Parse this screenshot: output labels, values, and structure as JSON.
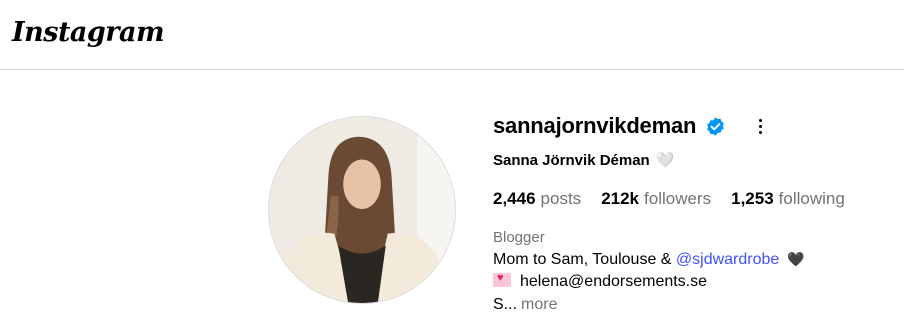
{
  "header": {
    "logo": "Instagram"
  },
  "profile": {
    "username": "sannajornvikdeman",
    "full_name": "Sanna Jörnvik Déman",
    "full_name_emoji": "🤍",
    "stats": {
      "posts_count": "2,446",
      "posts_label": "posts",
      "followers_count": "212k",
      "followers_label": "followers",
      "following_count": "1,253",
      "following_label": "following"
    },
    "category": "Blogger",
    "bio": {
      "line1_prefix": "Mom to Sam, Toulouse & ",
      "line1_mention": "@sjdwardrobe",
      "line1_emoji": "🖤",
      "line2_email": "helena@endorsements.se",
      "line3_truncated": "S...",
      "more_label": "more"
    }
  },
  "icons": {
    "verified_badge": "verified-badge-icon",
    "options": "more-options-icon",
    "mail": "love-letter-icon"
  },
  "colors": {
    "verified": "#0095f6",
    "mention": "#4150f7",
    "secondary_text": "#737373"
  }
}
